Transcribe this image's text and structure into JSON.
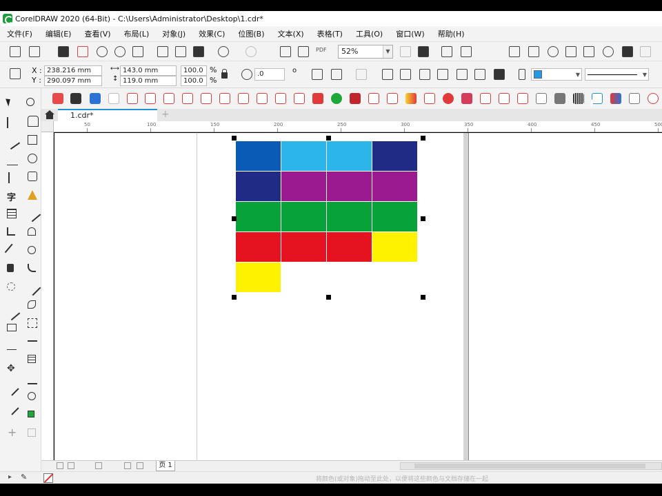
{
  "window": {
    "title": "CorelDRAW 2020 (64-Bit) - C:\\Users\\Administrator\\Desktop\\1.cdr*"
  },
  "menu": [
    {
      "label": "文件(F)",
      "name": "menu-file"
    },
    {
      "label": "编辑(E)",
      "name": "menu-edit"
    },
    {
      "label": "查看(V)",
      "name": "menu-view"
    },
    {
      "label": "布局(L)",
      "name": "menu-layout"
    },
    {
      "label": "对象(J)",
      "name": "menu-object"
    },
    {
      "label": "效果(C)",
      "name": "menu-effects"
    },
    {
      "label": "位图(B)",
      "name": "menu-bitmaps"
    },
    {
      "label": "文本(X)",
      "name": "menu-text"
    },
    {
      "label": "表格(T)",
      "name": "menu-table"
    },
    {
      "label": "工具(O)",
      "name": "menu-tools"
    },
    {
      "label": "窗口(W)",
      "name": "menu-window"
    },
    {
      "label": "帮助(H)",
      "name": "menu-help"
    }
  ],
  "toolbar": {
    "zoom_value": "52%",
    "pdf_label": "PDF"
  },
  "properties": {
    "x_label": "X :",
    "y_label": "Y :",
    "x_value": "238.216 mm",
    "y_value": "290.097 mm",
    "width_value": "143.0 mm",
    "height_value": "119.0 mm",
    "scale_w": "100.0",
    "scale_h": "100.0",
    "pct_w": "%",
    "pct_h": "%",
    "rotation_value": ".0",
    "degree_symbol": "o",
    "fill_color": "#1f9bea"
  },
  "document": {
    "tab_label": "1.cdr*",
    "page_tab": "页 1"
  },
  "ruler": {
    "labels": [
      "50",
      "100",
      "150",
      "200",
      "250",
      "300",
      "350",
      "400",
      "450",
      "500"
    ]
  },
  "swatch_grid": {
    "rows": [
      [
        "#0a5bb5",
        "#2bb5e8",
        "#2bb5e8",
        "#1f2b84"
      ],
      [
        "#1f2b84",
        "#9b1a8f",
        "#9b1a8f",
        "#9b1a8f"
      ],
      [
        "#07a33a",
        "#07a33a",
        "#07a33a",
        "#07a33a"
      ],
      [
        "#e5121f",
        "#e5121f",
        "#e5121f",
        "#fff200"
      ],
      [
        "#fff200"
      ]
    ]
  },
  "status": {
    "hint": "将颜色(或对象)拖动至此处，以便将这些颜色与文档存储在一起"
  },
  "icons": {
    "home": "home-icon",
    "pick": "pick-tool-icon",
    "lock": "lock-icon",
    "no_color": "no-color-icon",
    "add": "add-icon"
  }
}
